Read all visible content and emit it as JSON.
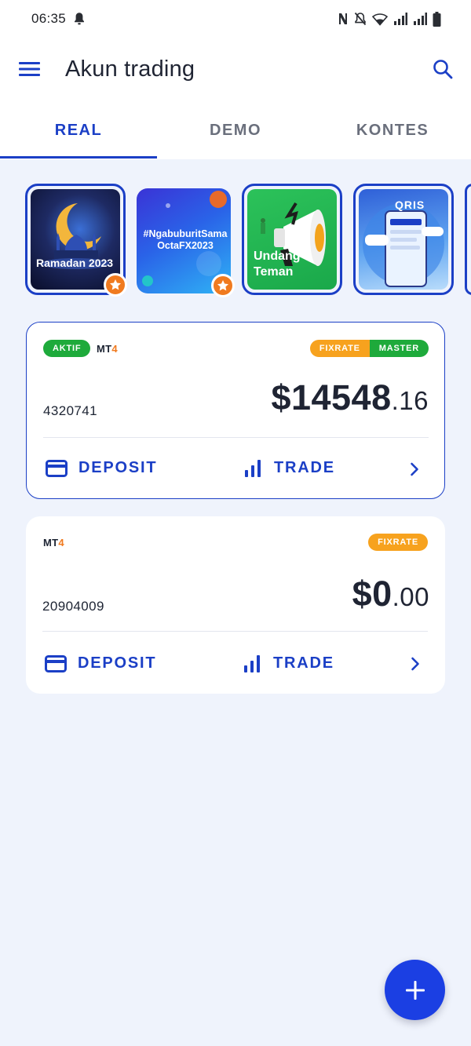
{
  "status_bar": {
    "time": "06:35",
    "icons": [
      "bell-icon",
      "nfc-icon",
      "mute-bell-icon",
      "wifi-icon",
      "signal-icon",
      "signal-icon",
      "battery-icon"
    ]
  },
  "app_bar": {
    "title": "Akun trading",
    "menu_icon": "menu-icon",
    "search_icon": "search-icon"
  },
  "tabs": [
    {
      "label": "REAL",
      "active": true
    },
    {
      "label": "DEMO",
      "active": false
    },
    {
      "label": "KONTES",
      "active": false
    }
  ],
  "stories": [
    {
      "label": "Ramadan 2023",
      "has_star": true
    },
    {
      "label": "#NgabuburitSama\nOctaFX2023",
      "has_star": true
    },
    {
      "label": "Undang\nTeman",
      "has_star": false
    },
    {
      "label": "QRIS",
      "has_star": false
    }
  ],
  "accounts": [
    {
      "status": "AKTIF",
      "platform_prefix": "MT",
      "platform_suffix": "4",
      "tags": [
        "FIXRATE",
        "MASTER"
      ],
      "account_number": "4320741",
      "balance_main": "$14548",
      "balance_cents": ".16",
      "deposit_label": "DEPOSIT",
      "trade_label": "TRADE",
      "selected": true
    },
    {
      "platform_prefix": "MT",
      "platform_suffix": "4",
      "tags": [
        "FIXRATE"
      ],
      "account_number": "20904009",
      "balance_main": "$0",
      "balance_cents": ".00",
      "deposit_label": "DEPOSIT",
      "trade_label": "TRADE",
      "selected": false
    }
  ],
  "fab_icon": "plus-icon",
  "colors": {
    "accent": "#1b3fc6",
    "background": "#eff3fc",
    "active_badge": "#1eaa3b",
    "fixrate_badge": "#f7a21e",
    "mt4_orange": "#f07a1f"
  }
}
